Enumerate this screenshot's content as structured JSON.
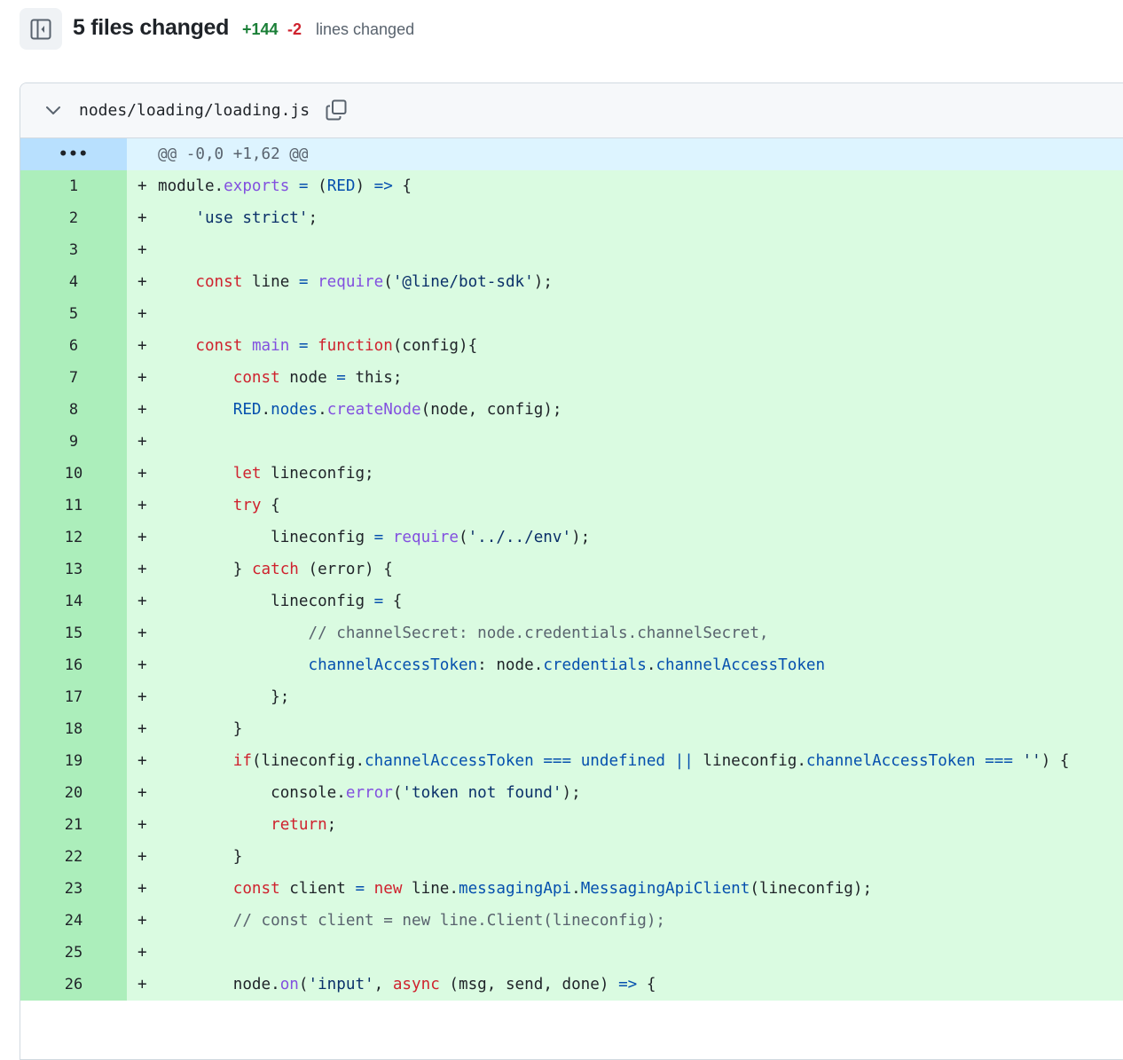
{
  "header": {
    "files_changed": "5 files changed",
    "additions": "+144",
    "deletions": "-2",
    "lines_changed_label": "lines changed"
  },
  "file": {
    "path": "nodes/loading/loading.js"
  },
  "hunk": {
    "expander": "•••",
    "text": "@@ -0,0 +1,62 @@"
  },
  "lines": [
    {
      "n": "1",
      "t": [
        [
          "module.",
          ""
        ],
        [
          "exports",
          "fn"
        ],
        [
          " ",
          ""
        ],
        [
          "=",
          "op"
        ],
        [
          " (",
          ""
        ],
        [
          "RED",
          "prop"
        ],
        [
          ") ",
          ""
        ],
        [
          "=>",
          "op"
        ],
        [
          " {",
          ""
        ]
      ]
    },
    {
      "n": "2",
      "t": [
        [
          "    ",
          ""
        ],
        [
          "'use strict'",
          "str"
        ],
        [
          ";",
          ""
        ]
      ]
    },
    {
      "n": "3",
      "t": []
    },
    {
      "n": "4",
      "t": [
        [
          "    ",
          ""
        ],
        [
          "const",
          "kw"
        ],
        [
          " line ",
          ""
        ],
        [
          "=",
          "op"
        ],
        [
          " ",
          ""
        ],
        [
          "require",
          "fn"
        ],
        [
          "(",
          ""
        ],
        [
          "'@line/bot-sdk'",
          "str"
        ],
        [
          ");",
          ""
        ]
      ]
    },
    {
      "n": "5",
      "t": []
    },
    {
      "n": "6",
      "t": [
        [
          "    ",
          ""
        ],
        [
          "const",
          "kw"
        ],
        [
          " ",
          ""
        ],
        [
          "main",
          "fn"
        ],
        [
          " ",
          ""
        ],
        [
          "=",
          "op"
        ],
        [
          " ",
          ""
        ],
        [
          "function",
          "kw"
        ],
        [
          "(config){",
          ""
        ]
      ]
    },
    {
      "n": "7",
      "t": [
        [
          "        ",
          ""
        ],
        [
          "const",
          "kw"
        ],
        [
          " node ",
          ""
        ],
        [
          "=",
          "op"
        ],
        [
          " this;",
          ""
        ]
      ]
    },
    {
      "n": "8",
      "t": [
        [
          "        ",
          ""
        ],
        [
          "RED",
          "prop"
        ],
        [
          ".",
          ""
        ],
        [
          "nodes",
          "prop"
        ],
        [
          ".",
          ""
        ],
        [
          "createNode",
          "fn"
        ],
        [
          "(node, config);",
          ""
        ]
      ]
    },
    {
      "n": "9",
      "t": []
    },
    {
      "n": "10",
      "t": [
        [
          "        ",
          ""
        ],
        [
          "let",
          "kw"
        ],
        [
          " lineconfig;",
          ""
        ]
      ]
    },
    {
      "n": "11",
      "t": [
        [
          "        ",
          ""
        ],
        [
          "try",
          "kw"
        ],
        [
          " {",
          ""
        ]
      ]
    },
    {
      "n": "12",
      "t": [
        [
          "            lineconfig ",
          ""
        ],
        [
          "=",
          "op"
        ],
        [
          " ",
          ""
        ],
        [
          "require",
          "fn"
        ],
        [
          "(",
          ""
        ],
        [
          "'../../env'",
          "str"
        ],
        [
          ");",
          ""
        ]
      ]
    },
    {
      "n": "13",
      "t": [
        [
          "        } ",
          ""
        ],
        [
          "catch",
          "kw"
        ],
        [
          " (error) {",
          ""
        ]
      ]
    },
    {
      "n": "14",
      "t": [
        [
          "            lineconfig ",
          ""
        ],
        [
          "=",
          "op"
        ],
        [
          " {",
          ""
        ]
      ]
    },
    {
      "n": "15",
      "t": [
        [
          "                ",
          ""
        ],
        [
          "// channelSecret: node.credentials.channelSecret,",
          "com"
        ]
      ]
    },
    {
      "n": "16",
      "t": [
        [
          "                ",
          ""
        ],
        [
          "channelAccessToken",
          "prop"
        ],
        [
          ": node.",
          ""
        ],
        [
          "credentials",
          "prop"
        ],
        [
          ".",
          ""
        ],
        [
          "channelAccessToken",
          "prop"
        ]
      ]
    },
    {
      "n": "17",
      "t": [
        [
          "            };",
          ""
        ]
      ]
    },
    {
      "n": "18",
      "t": [
        [
          "        }",
          ""
        ]
      ]
    },
    {
      "n": "19",
      "t": [
        [
          "        ",
          ""
        ],
        [
          "if",
          "kw"
        ],
        [
          "(lineconfig.",
          ""
        ],
        [
          "channelAccessToken",
          "prop"
        ],
        [
          " ",
          ""
        ],
        [
          "===",
          "op"
        ],
        [
          " ",
          ""
        ],
        [
          "undefined",
          "prop"
        ],
        [
          " ",
          ""
        ],
        [
          "||",
          "op"
        ],
        [
          " lineconfig.",
          ""
        ],
        [
          "channelAccessToken",
          "prop"
        ],
        [
          " ",
          ""
        ],
        [
          "===",
          "op"
        ],
        [
          " ",
          ""
        ],
        [
          "''",
          "str"
        ],
        [
          ") {",
          ""
        ]
      ]
    },
    {
      "n": "20",
      "t": [
        [
          "            console.",
          ""
        ],
        [
          "error",
          "fn"
        ],
        [
          "(",
          ""
        ],
        [
          "'token not found'",
          "str"
        ],
        [
          ");",
          ""
        ]
      ]
    },
    {
      "n": "21",
      "t": [
        [
          "            ",
          ""
        ],
        [
          "return",
          "kw"
        ],
        [
          ";",
          ""
        ]
      ]
    },
    {
      "n": "22",
      "t": [
        [
          "        }",
          ""
        ]
      ]
    },
    {
      "n": "23",
      "t": [
        [
          "        ",
          ""
        ],
        [
          "const",
          "kw"
        ],
        [
          " client ",
          ""
        ],
        [
          "=",
          "op"
        ],
        [
          " ",
          ""
        ],
        [
          "new",
          "kw"
        ],
        [
          " line.",
          ""
        ],
        [
          "messagingApi",
          "prop"
        ],
        [
          ".",
          ""
        ],
        [
          "MessagingApiClient",
          "prop"
        ],
        [
          "(lineconfig);",
          ""
        ]
      ]
    },
    {
      "n": "24",
      "t": [
        [
          "        ",
          ""
        ],
        [
          "// const client = new line.Client(lineconfig);",
          "com"
        ]
      ]
    },
    {
      "n": "25",
      "t": []
    },
    {
      "n": "26",
      "t": [
        [
          "        node.",
          ""
        ],
        [
          "on",
          "fn"
        ],
        [
          "(",
          ""
        ],
        [
          "'input'",
          "str"
        ],
        [
          ", ",
          ""
        ],
        [
          "async",
          "kw"
        ],
        [
          " (msg, send, done) ",
          ""
        ],
        [
          "=>",
          "op"
        ],
        [
          " {",
          ""
        ]
      ]
    }
  ],
  "add_sign": "+",
  "icons": {
    "sidebar_toggle": "sidebar-collapse-icon",
    "chevron": "chevron-down-icon",
    "copy": "copy-icon"
  },
  "colors": {
    "addition": "#1a7f37",
    "deletion": "#cf222e",
    "added_line_bg": "#dafbe1",
    "added_num_bg": "#aceebb",
    "hunk_bg": "#ddf4ff"
  }
}
